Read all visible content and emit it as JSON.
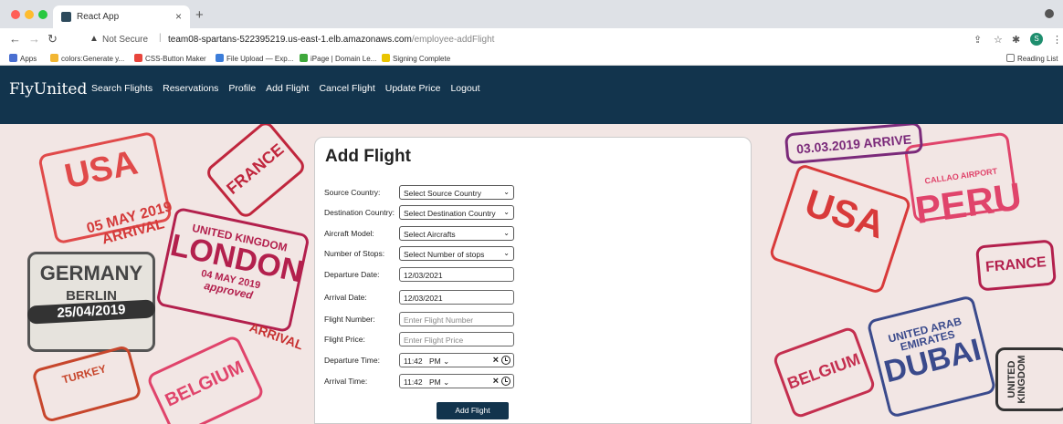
{
  "browser": {
    "tab_title": "React App",
    "url_warning": "Not Secure",
    "url_domain": "team08-spartans-522395219.us-east-1.elb.amazonaws.com",
    "url_path": "/employee-addFlight",
    "bookmarks": [
      "Apps",
      "colors:Generate y...",
      "CSS-Button Maker",
      "File Upload — Exp...",
      "iPage | Domain Le...",
      "Signing Complete"
    ],
    "reading_list": "Reading List",
    "profile_initial": "S"
  },
  "app": {
    "brand": "FlyUnited",
    "nav": [
      "Search Flights",
      "Reservations",
      "Profile",
      "Add Flight",
      "Cancel Flight",
      "Update Price",
      "Logout"
    ]
  },
  "stamps": [
    "USA",
    "05 MAY 2019",
    "ARRIVAL",
    "GERMANY",
    "BERLIN",
    "25/04/2019",
    "UNITED KINGDOM",
    "LONDON",
    "04 MAY 2019",
    "approved",
    "FRANCE",
    "BELGIUM",
    "PERU",
    "CALLAO AIRPORT",
    "03.03.2019 ARRIVE",
    "UNITED ARAB EMIRATES",
    "DUBAI",
    "UNITED KINGDOM",
    "TURKEY",
    "ARRIVAL"
  ],
  "form": {
    "title": "Add Flight",
    "source_label": "Source Country:",
    "source_value": "Select Source Country",
    "dest_label": "Destination Country:",
    "dest_value": "Select Destination Country",
    "aircraft_label": "Aircraft Model:",
    "aircraft_value": "Select Aircrafts",
    "stops_label": "Number of Stops:",
    "stops_value": "Select Number of stops",
    "dep_date_label": "Departure Date:",
    "dep_date_value": "12/03/2021",
    "arr_date_label": "Arrival Date:",
    "arr_date_value": "12/03/2021",
    "flight_number_label": "Flight Number:",
    "flight_number_placeholder": "Enter Flight Number",
    "flight_price_label": "Flight Price:",
    "flight_price_placeholder": "Enter Flight Price",
    "dep_time_label": "Departure Time:",
    "dep_time_value": "11:42",
    "dep_time_ampm": "PM",
    "arr_time_label": "Arrival Time:",
    "arr_time_value": "11:42",
    "arr_time_ampm": "PM",
    "submit_label": "Add Flight"
  },
  "colors": {
    "nav": "#12344d",
    "button": "#12344d",
    "profile": "#1e8e6e"
  }
}
